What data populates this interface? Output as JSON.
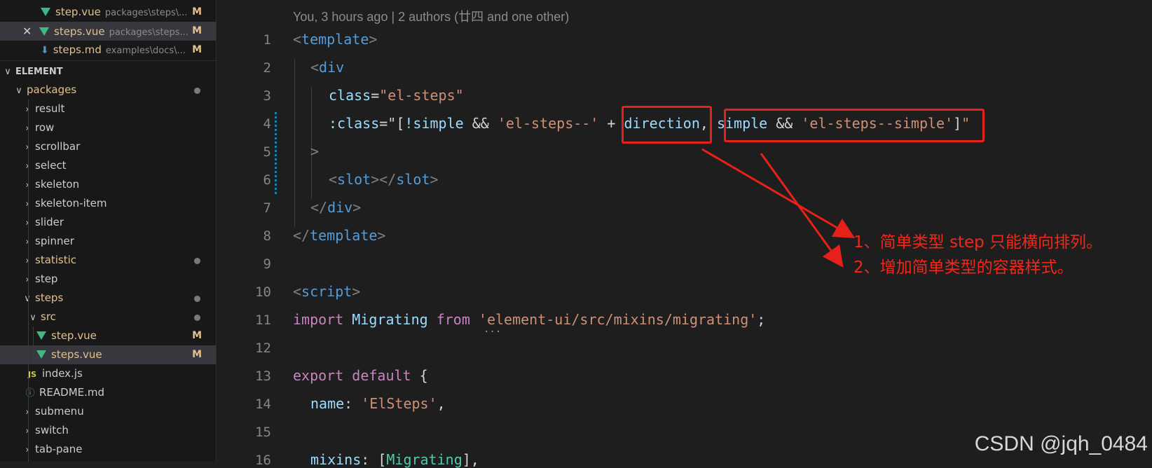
{
  "sidebar": {
    "open_editors": [
      {
        "name": "step.vue",
        "path": "packages\\steps\\...",
        "status": "M"
      },
      {
        "name": "steps.vue",
        "path": "packages\\steps...",
        "status": "M"
      },
      {
        "name": "steps.md",
        "path": "examples\\docs\\...",
        "status": "M"
      }
    ],
    "section_title": "ELEMENT",
    "tree": {
      "packages": "packages",
      "items": [
        "result",
        "row",
        "scrollbar",
        "select",
        "skeleton",
        "skeleton-item",
        "slider",
        "spinner",
        "statistic",
        "step",
        "steps"
      ],
      "src": "src",
      "src_files": [
        {
          "name": "step.vue",
          "status": "M"
        },
        {
          "name": "steps.vue",
          "status": "M"
        }
      ],
      "index_js": "index.js",
      "readme": "README.md",
      "more_items": [
        "submenu",
        "switch",
        "tab-pane"
      ]
    },
    "icons": {
      "close": "close-icon",
      "chevron": "chevron-icon",
      "vue": "vue-file-icon",
      "markdown": "markdown-icon",
      "js": "js-icon",
      "info": "info-icon"
    },
    "colors": {
      "modified": "#e2c08d",
      "vue": "#41b883"
    }
  },
  "editor": {
    "blame": "You, 3 hours ago | 2 authors (廿四 and one other)",
    "line_numbers": [
      "1",
      "2",
      "3",
      "4",
      "5",
      "6",
      "7",
      "8",
      "9",
      "10",
      "11",
      "12",
      "13",
      "14",
      "15",
      "16"
    ],
    "lines": {
      "l1_open": "<",
      "l1_tag": "template",
      "l1_close": ">",
      "l2_open": "<",
      "l2_tag": "div",
      "l3_attr": "class",
      "l3_eq": "=",
      "l3_val": "\"el-steps\"",
      "l4_attr": ":class",
      "l4_eq": "=",
      "l4_q1": "\"[",
      "l4_a": "!simple",
      "l4_b": " && ",
      "l4_c": "'el-steps--'",
      "l4_d": " + ",
      "l4_e": "direction",
      "l4_f": ", ",
      "l4_g": "simple",
      "l4_h": " && ",
      "l4_i": "'el-steps--simple'",
      "l4_j": "]",
      "l4_q2": "\"",
      "l5": ">",
      "l6_a": "<",
      "l6_b": "slot",
      "l6_c": "></",
      "l6_d": "slot",
      "l6_e": ">",
      "l7_a": "</",
      "l7_b": "div",
      "l7_c": ">",
      "l8_a": "</",
      "l8_b": "template",
      "l8_c": ">",
      "l10_a": "<",
      "l10_b": "script",
      "l10_c": ">",
      "l11_a": "import",
      "l11_b": " Migrating ",
      "l11_c": "from",
      "l11_d": " ",
      "l11_e": "'element-ui/src/mixins/migrating'",
      "l11_f": ";",
      "l13_a": "export",
      "l13_b": " ",
      "l13_c": "default",
      "l13_d": " {",
      "l14_a": "name",
      "l14_b": ": ",
      "l14_c": "'ElSteps'",
      "l14_d": ",",
      "l16_a": "mixins",
      "l16_b": ": [",
      "l16_c": "Migrating",
      "l16_d": "],"
    },
    "hint": "..."
  },
  "annotations": {
    "note1": "1、简单类型 step 只能横向排列。",
    "note2": "2、增加简单类型的容器样式。",
    "color": "#e8201a"
  },
  "watermark": "CSDN @jqh_0484"
}
